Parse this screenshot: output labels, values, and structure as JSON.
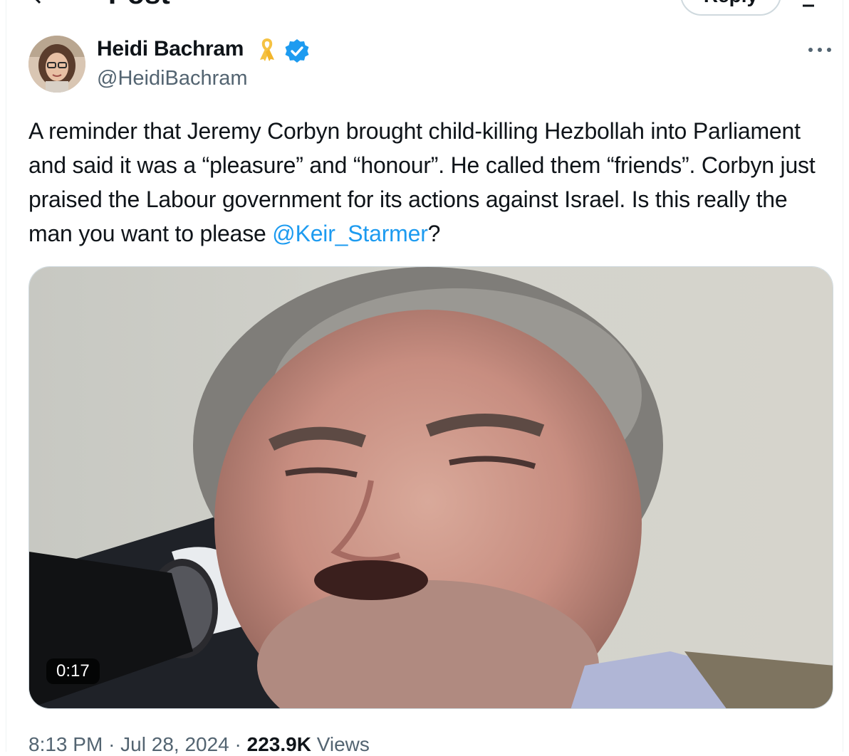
{
  "topbar": {
    "title": "Post",
    "reply_label": "Reply"
  },
  "author": {
    "name": "Heidi Bachram",
    "handle": "@HeidiBachram"
  },
  "tweet": {
    "text_before": "A reminder that Jeremy Corbyn brought child-killing Hezbollah into Parliament and said it was a “pleasure” and “honour”. He called them “friends”. Corbyn just praised the Labour government for its actions against Israel. Is this really the man you want to please ",
    "mention": "@Keir_Starmer",
    "text_after": "?"
  },
  "media": {
    "duration": "0:17"
  },
  "meta": {
    "time": "8:13 PM",
    "separator": "·",
    "date": "Jul 28, 2024",
    "views_count": "223.9K",
    "views_label": "Views"
  },
  "colors": {
    "text": "#0f1419",
    "secondary": "#536471",
    "accent": "#1d9bf0",
    "ribbon": "#f5c243"
  },
  "icons": {
    "back": "arrow-left-icon",
    "ribbon": "yellow-ribbon-icon",
    "verified": "verified-badge-icon",
    "more": "more-horizontal-icon",
    "expand": "expand-icon"
  }
}
